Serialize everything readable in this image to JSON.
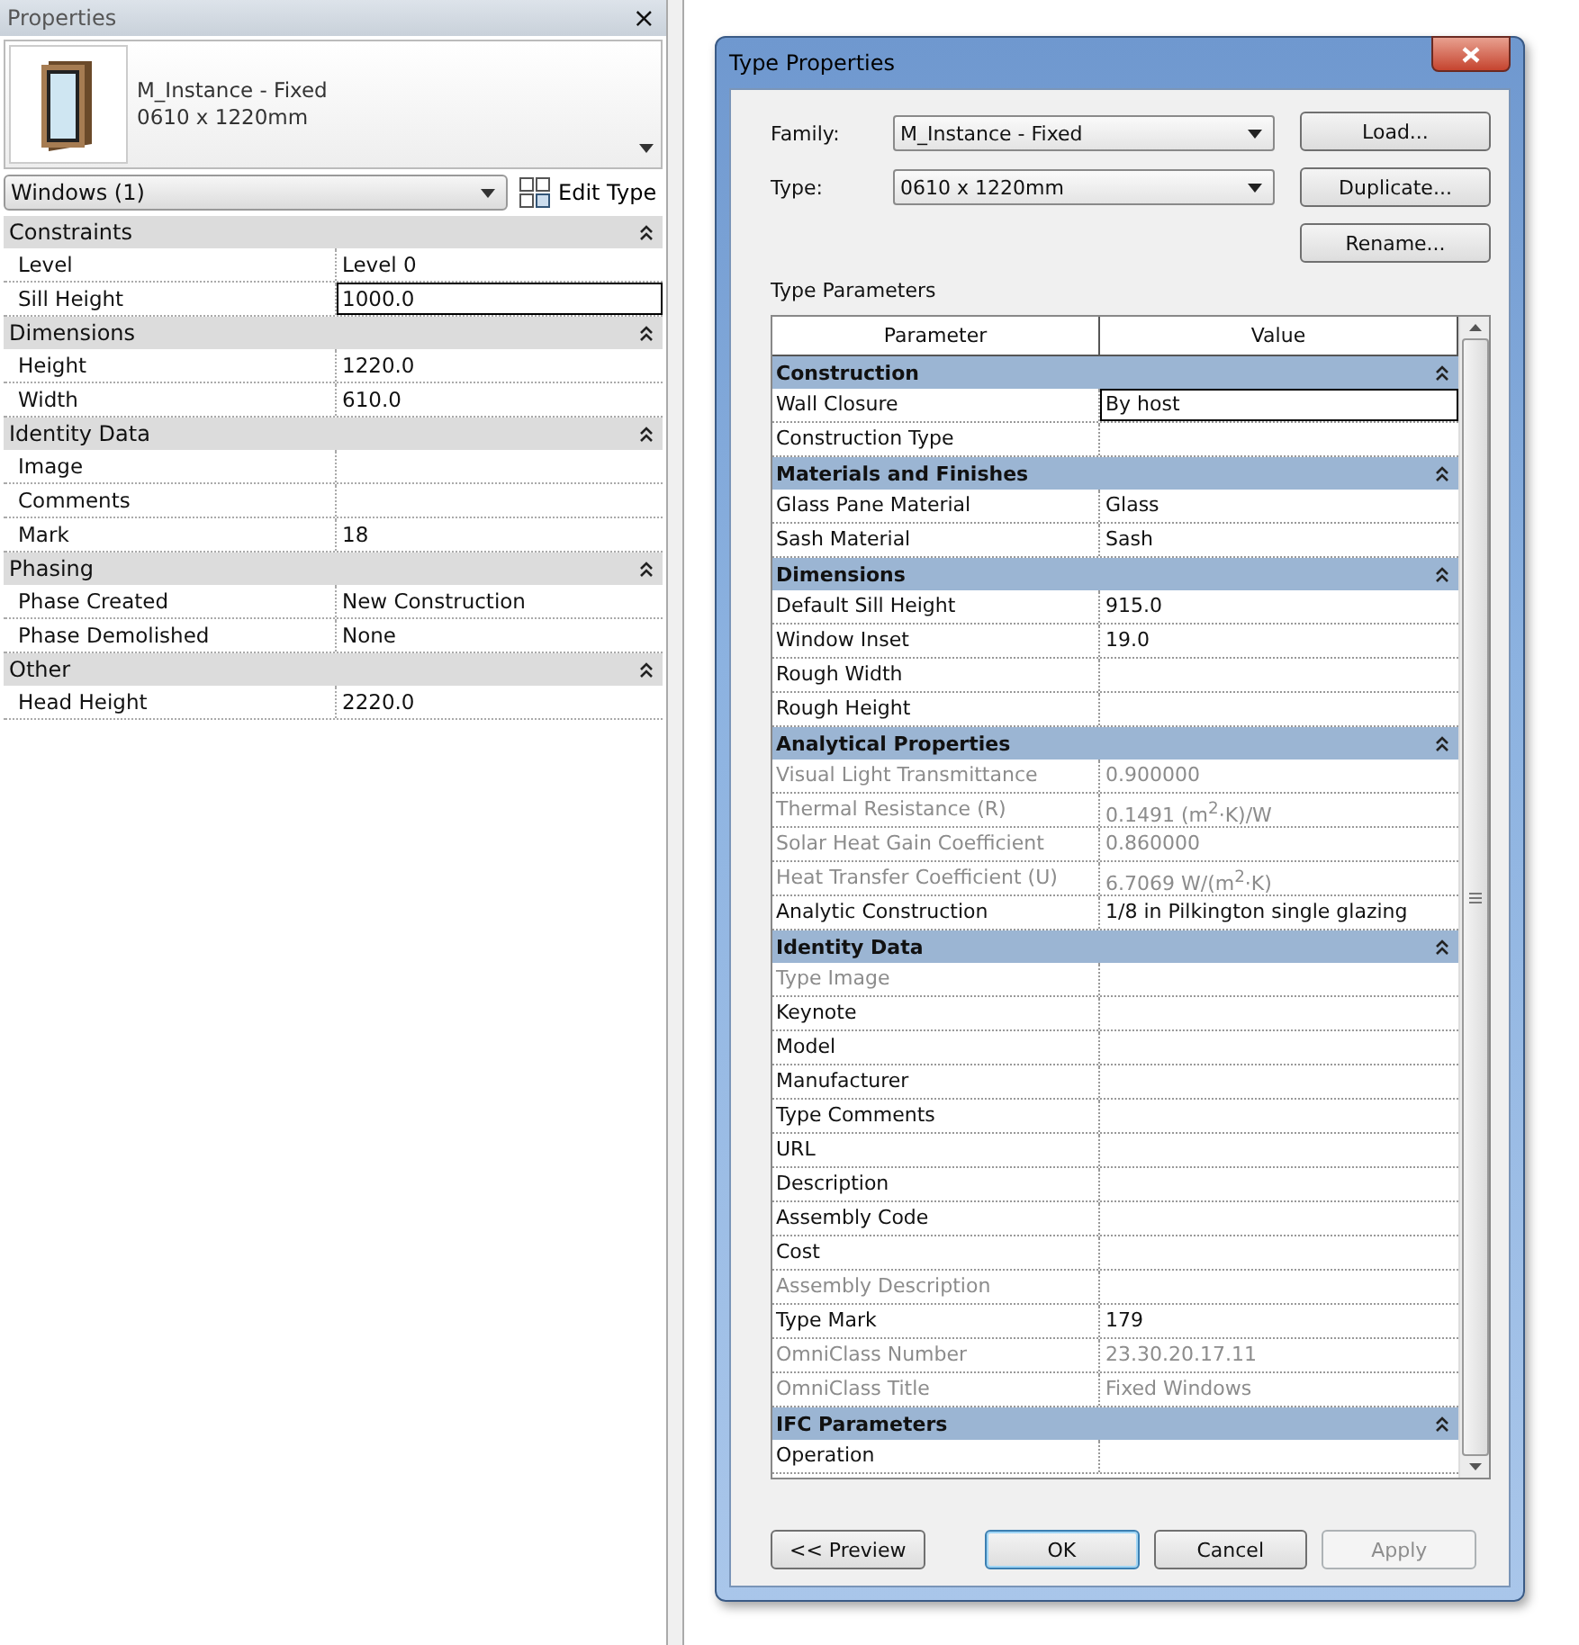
{
  "properties_panel": {
    "title": "Properties",
    "close": "×",
    "type_selector": {
      "name": "M_Instance - Fixed",
      "size": "0610 x 1220mm"
    },
    "category_dropdown": "Windows (1)",
    "edit_type": "Edit Type",
    "groups": [
      {
        "name": "Constraints",
        "expanded": true,
        "rows": [
          {
            "name": "Level",
            "value": "Level 0",
            "focused": false
          },
          {
            "name": "Sill Height",
            "value": "1000.0",
            "focused": true
          }
        ]
      },
      {
        "name": "Dimensions",
        "expanded": true,
        "rows": [
          {
            "name": "Height",
            "value": "1220.0",
            "focused": false
          },
          {
            "name": "Width",
            "value": "610.0",
            "focused": false
          }
        ]
      },
      {
        "name": "Identity Data",
        "expanded": true,
        "rows": [
          {
            "name": "Image",
            "value": "",
            "focused": false
          },
          {
            "name": "Comments",
            "value": "",
            "focused": false
          },
          {
            "name": "Mark",
            "value": "18",
            "focused": false
          }
        ]
      },
      {
        "name": "Phasing",
        "expanded": true,
        "rows": [
          {
            "name": "Phase Created",
            "value": "New Construction",
            "focused": false
          },
          {
            "name": "Phase Demolished",
            "value": "None",
            "focused": false
          }
        ]
      },
      {
        "name": "Other",
        "expanded": true,
        "rows": [
          {
            "name": "Head Height",
            "value": "2220.0",
            "focused": false
          }
        ]
      }
    ]
  },
  "dialog": {
    "title": "Type Properties",
    "family_label": "Family:",
    "family": "M_Instance - Fixed",
    "type_label": "Type:",
    "type": "0610 x 1220mm",
    "side_buttons": [
      "Load...",
      "Duplicate...",
      "Rename..."
    ],
    "params_label": "Type Parameters",
    "columns": [
      "Parameter",
      "Value"
    ],
    "groups": [
      {
        "name": "Construction",
        "expanded": true,
        "rows": [
          {
            "name": "Wall Closure",
            "value": "By host",
            "disabled": false,
            "focused": true
          },
          {
            "name": "Construction Type",
            "value": "",
            "disabled": false,
            "focused": false
          }
        ]
      },
      {
        "name": "Materials and Finishes",
        "expanded": true,
        "rows": [
          {
            "name": "Glass Pane Material",
            "value": "Glass",
            "disabled": false,
            "focused": false
          },
          {
            "name": "Sash Material",
            "value": "Sash",
            "disabled": false,
            "focused": false
          }
        ]
      },
      {
        "name": "Dimensions",
        "expanded": true,
        "rows": [
          {
            "name": "Default Sill Height",
            "value": "915.0",
            "disabled": false,
            "focused": false
          },
          {
            "name": "Window Inset",
            "value": "19.0",
            "disabled": false,
            "focused": false
          },
          {
            "name": "Rough Width",
            "value": "",
            "disabled": false,
            "focused": false
          },
          {
            "name": "Rough Height",
            "value": "",
            "disabled": false,
            "focused": false
          }
        ]
      },
      {
        "name": "Analytical Properties",
        "expanded": true,
        "rows": [
          {
            "name": "Visual Light Transmittance",
            "value": "0.900000",
            "disabled": true,
            "focused": false
          },
          {
            "name": "Thermal Resistance (R)",
            "value": "0.1491 (m$^{2}$·K)/W",
            "disabled": true,
            "focused": false
          },
          {
            "name": "Solar Heat Gain Coefficient",
            "value": "0.860000",
            "disabled": true,
            "focused": false
          },
          {
            "name": "Heat Transfer Coefficient (U)",
            "value": "6.7069 W/(m$^{2}$·K)",
            "disabled": true,
            "focused": false
          },
          {
            "name": "Analytic Construction",
            "value": "1/8 in Pilkington single glazing",
            "disabled": false,
            "focused": false
          }
        ]
      },
      {
        "name": "Identity Data",
        "expanded": true,
        "rows": [
          {
            "name": "Type Image",
            "value": "",
            "disabled": true,
            "focused": false
          },
          {
            "name": "Keynote",
            "value": "",
            "disabled": false,
            "focused": false
          },
          {
            "name": "Model",
            "value": "",
            "disabled": false,
            "focused": false
          },
          {
            "name": "Manufacturer",
            "value": "",
            "disabled": false,
            "focused": false
          },
          {
            "name": "Type Comments",
            "value": "",
            "disabled": false,
            "focused": false
          },
          {
            "name": "URL",
            "value": "",
            "disabled": false,
            "focused": false
          },
          {
            "name": "Description",
            "value": "",
            "disabled": false,
            "focused": false
          },
          {
            "name": "Assembly Code",
            "value": "",
            "disabled": false,
            "focused": false
          },
          {
            "name": "Cost",
            "value": "",
            "disabled": false,
            "focused": false
          },
          {
            "name": "Assembly Description",
            "value": "",
            "disabled": true,
            "focused": false
          },
          {
            "name": "Type Mark",
            "value": "179",
            "disabled": false,
            "focused": false
          },
          {
            "name": "OmniClass Number",
            "value": "23.30.20.17.11",
            "disabled": true,
            "focused": false
          },
          {
            "name": "OmniClass Title",
            "value": "Fixed Windows",
            "disabled": true,
            "focused": false
          }
        ]
      },
      {
        "name": "IFC Parameters",
        "expanded": true,
        "rows": [
          {
            "name": "Operation",
            "value": "",
            "disabled": false,
            "focused": false
          }
        ]
      }
    ],
    "buttons": [
      {
        "label": "<< Preview",
        "default": false,
        "disabled": false
      },
      {
        "label": "OK",
        "default": true,
        "disabled": false
      },
      {
        "label": "Cancel",
        "default": false,
        "disabled": false
      },
      {
        "label": "Apply",
        "default": false,
        "disabled": true
      }
    ]
  }
}
